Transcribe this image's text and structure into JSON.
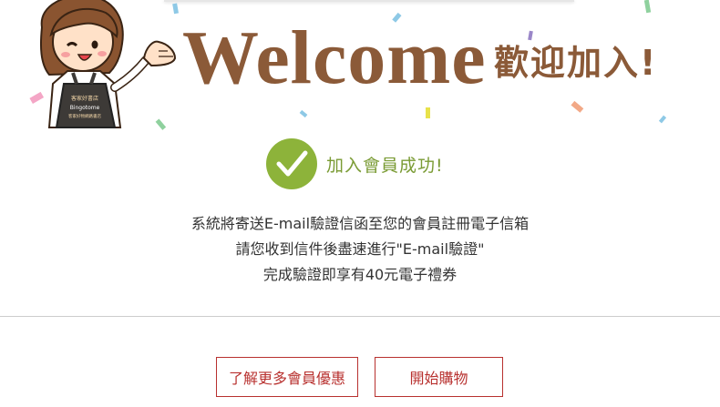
{
  "banner": {
    "welcome_word": "Welcome",
    "welcome_cjk": "歡迎加入!",
    "mascot_logo_text": "Bingotome",
    "mascot_apron_line1": "客家好書店",
    "mascot_apron_line2": "客家好物網路書店"
  },
  "success": {
    "icon": "checkmark-icon",
    "text": "加入會員成功!"
  },
  "message": {
    "line1": "系統將寄送E-mail驗證信函至您的會員註冊電子信箱",
    "line2": "請您收到信件後盡速進行\"E-mail驗證\"",
    "line3": "完成驗證即享有40元電子禮券"
  },
  "actions": {
    "member_benefits_label": "了解更多會員優惠",
    "start_shopping_label": "開始購物"
  },
  "colors": {
    "brand_brown": "#8b5a38",
    "success_green": "#8db33a",
    "accent_red": "#b8312f"
  }
}
